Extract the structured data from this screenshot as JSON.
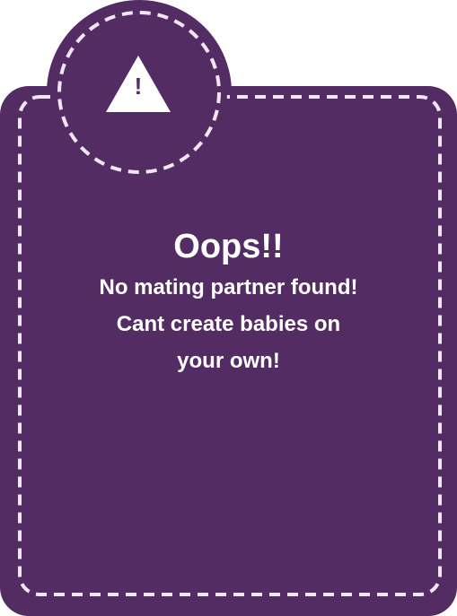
{
  "dialog": {
    "icon": "warning-icon",
    "icon_glyph": "!",
    "title": "Oops!!",
    "lines": [
      "No mating partner found!",
      "Cant create babies on",
      "your own!"
    ]
  },
  "colors": {
    "panel": "#532c64",
    "dash": "#f1e6f6",
    "text": "#ffffff"
  }
}
